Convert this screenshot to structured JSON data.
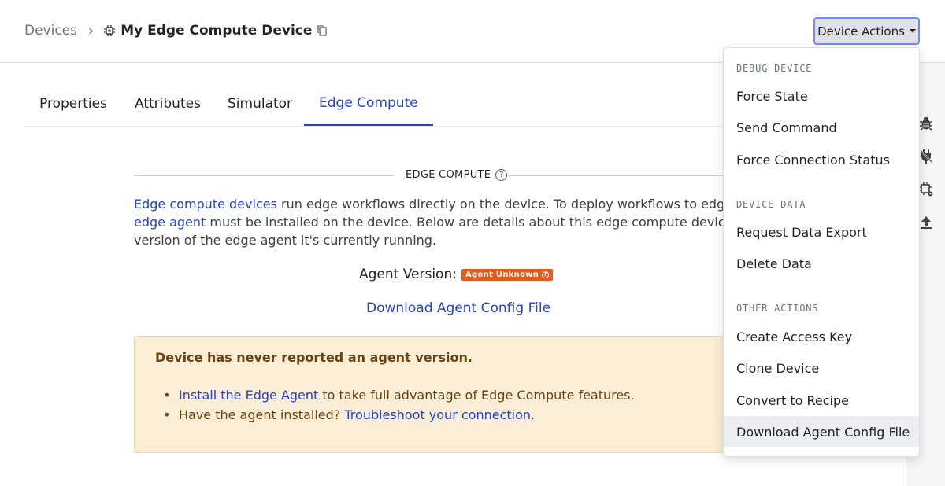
{
  "breadcrumb": {
    "root": "Devices",
    "separator": "›",
    "device_name": "My Edge Compute Device"
  },
  "header": {
    "actions_label": "Device Actions"
  },
  "tabs": [
    {
      "label": "Properties",
      "active": false
    },
    {
      "label": "Attributes",
      "active": false
    },
    {
      "label": "Simulator",
      "active": false
    },
    {
      "label": "Edge Compute",
      "active": true
    }
  ],
  "section": {
    "title": "EDGE COMPUTE",
    "desc_link1": "Edge compute devices",
    "desc_part1": " run edge workflows directly on the device. To deploy workflows to edge devices, an",
    "desc_link2": "edge agent",
    "desc_part2": " must be installed on the device. Below are details about this edge compute device and the",
    "desc_part3": "version of the edge agent it's currently running.",
    "agent_version_label": "Agent Version:",
    "agent_badge": "Agent Unknown",
    "download_link": "Download Agent Config File"
  },
  "alert": {
    "title": "Device has never reported an agent version.",
    "item1_link": "Install the Edge Agent",
    "item1_text": " to take full advantage of Edge Compute features.",
    "item2_text": "Have the agent installed? ",
    "item2_link": "Troubleshoot your connection",
    "item2_end": "."
  },
  "menu": {
    "groups": [
      {
        "header": "DEBUG DEVICE",
        "items": [
          "Force State",
          "Send Command",
          "Force Connection Status"
        ]
      },
      {
        "header": "DEVICE DATA",
        "items": [
          "Request Data Export",
          "Delete Data"
        ]
      },
      {
        "header": "OTHER ACTIONS",
        "items": [
          "Create Access Key",
          "Clone Device",
          "Convert to Recipe",
          "Download Agent Config File"
        ]
      }
    ],
    "highlighted_item": "Download Agent Config File"
  },
  "rail_icons": [
    "bug-icon",
    "plug-icon",
    "chip-icon",
    "upload-icon"
  ],
  "colors": {
    "accent": "#2442d4",
    "badge": "#e65c1b",
    "alert_bg": "#fbeed6",
    "alert_text": "#6b4312"
  }
}
